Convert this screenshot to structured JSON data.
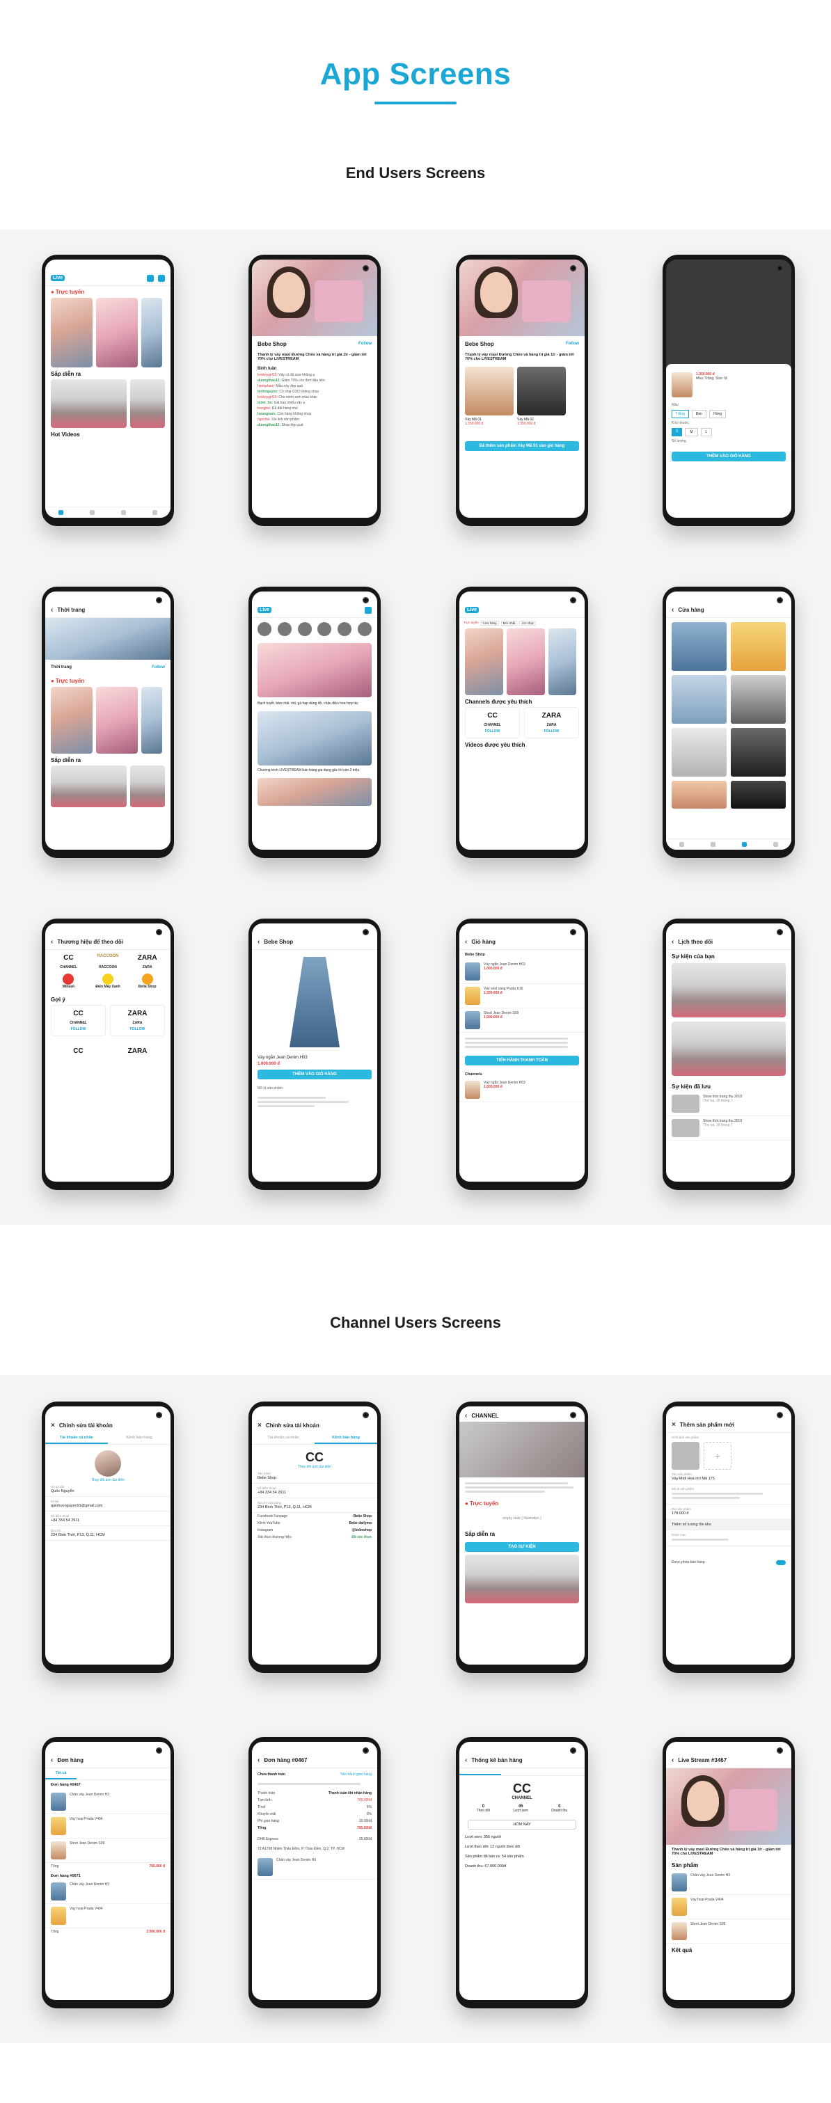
{
  "page": {
    "title": "App Screens",
    "section_end_users": "End Users Screens",
    "section_channel_users": "Channel Users Screens"
  },
  "colors": {
    "accent": "#1aa7d6",
    "live": "#e53935",
    "band": "#f4f4f5"
  },
  "screens": {
    "home": {
      "logo": "Live",
      "live": "Trực tuyến",
      "coming": "Sắp diễn ra",
      "hot": "Hot Videos"
    },
    "livestream": {
      "shop": "Bebe Shop",
      "follow": "Follow",
      "title": "Thanh lý váy maxi Đường Chéo và hàng trị giá 1tr - giảm tới 70% cho LIVESTREAM",
      "chat_title": "Bình luận"
    },
    "products": {
      "shop": "Bebe Shop",
      "follow": "Follow",
      "item1": "Váy Mã 01",
      "item2": "Váy Mã 02",
      "price1": "1.350.000 đ",
      "price2": "1.350.000 đ",
      "cta": "Đã thêm sản phẩm Váy Mã 01 vào giỏ hàng"
    },
    "variant": {
      "price": "1.350.000 đ",
      "color_label": "Màu",
      "size_label": "Kích thước",
      "qty_label": "Số lượng",
      "add": "THÊM VÀO GIỎ HÀNG"
    },
    "fashion": {
      "title": "Thời trang",
      "live": "Trực tuyến",
      "coming": "Sắp diễn ra",
      "follow": "Follow"
    },
    "categories": {
      "logo": "Live",
      "video1": "Bạch tuyết, bàn chải, nồi, gà hạp dùng đồ, chậu điện hoa hợp tác",
      "video2": "Chương trình LIVESTREAM bán hàng gia dụng giá chỉ còn 2 triệu"
    },
    "favorites": {
      "tab1": "Trực tuyến",
      "tab2": "Cửa hàng",
      "tab3": "Mới nhất",
      "tab4": "Âm nhạc",
      "channels_title": "Channels được yêu thích",
      "channel1": "CHANNEL",
      "channel2": "ZARA",
      "follow": "FOLLOW",
      "videos_title": "Videos được yêu thích"
    },
    "store": {
      "title": "Cửa hàng"
    },
    "brands": {
      "title": "Thương hiệu để theo dõi",
      "b1": "CHANNEL",
      "b2": "RACCOON",
      "b3": "ZARA",
      "b4": "Minasô",
      "b5": "Điện Máy Xanh",
      "b6": "Bella Shop",
      "suggest": "Gợi ý",
      "follow": "FOLLOW"
    },
    "product_detail": {
      "shop": "Bebe Shop",
      "name": "Váy ngắn Jean Denim H03",
      "price": "1.000.000 đ",
      "add": "THÊM VÀO GIỎ HÀNG",
      "desc": "Mô tả sản phẩm"
    },
    "cart": {
      "title": "Giỏ hàng",
      "shop": "Bebe Shop",
      "item1": "Váy ngắn Jean Denim H03",
      "item2": "Váy vest vàng Prada K16",
      "item3": "Short Jean Denim S09",
      "checkout": "TIẾN HÀNH THANH TOÁN",
      "shop2": "Channels"
    },
    "schedule": {
      "title": "Lịch theo dõi",
      "events_you": "Sự kiện của bạn",
      "events_saved": "Sự kiện đã lưu"
    },
    "edit_account": {
      "title": "Chỉnh sửa tài khoản",
      "tab1": "Tài khoản cá nhân",
      "tab2": "Kênh bán hàng",
      "change_photo": "Thay đổi ảnh đại diện",
      "name_label": "Họ và tên",
      "name": "Quốc Nguyễn",
      "email_label": "Email",
      "email": "quinhuonguyen91@gmail.com",
      "phone_label": "Số điện thoại",
      "phone": "+84 334 54 2911",
      "address_label": "Địa chỉ",
      "address": "234 Bình Thời, P13, Q.11, HCM"
    },
    "edit_channel": {
      "title": "Chỉnh sửa tài khoản",
      "tab1": "Tài khoản cá nhân",
      "tab2": "Kênh bán hàng",
      "change_photo": "Thay đổi ảnh đại diện",
      "name_label": "Tên kênh",
      "name": "Bebe Shop",
      "phone_label": "Số điện thoại",
      "phone": "+84 334 54 2911",
      "address_label": "Địa chỉ cửa hàng",
      "address": "234 Bình Thời, P13, Q.11, HCM",
      "fb_label": "Facebook Fanpage",
      "fb": "Bebe Shop",
      "yt_label": "Kênh YouTube",
      "yt": "Bebe dailymo",
      "ig_label": "Instagram",
      "ig": "@bebeshop",
      "verify_label": "Xác thực thương hiệu",
      "verify": "Đã xác thực"
    },
    "channel_page": {
      "title": "CHANNEL",
      "live": "Trực tuyến",
      "empty": "empty state ( illustration )",
      "coming": "Sắp diễn ra",
      "create": "TẠO SỰ KIỆN"
    },
    "add_product": {
      "title": "Thêm sản phẩm mới",
      "photos": "Hình ảnh sản phẩm",
      "name_label": "Tên sản phẩm",
      "name": "Váy Midi Hoa nhí Mã 175",
      "desc_label": "Mô tả sản phẩm",
      "price_label": "Giá sản phẩm",
      "price": "178.000 đ",
      "qty": "Thêm số lượng tồn kho",
      "category_label": "Danh mục",
      "allow": "Được phép bán hàng"
    },
    "orders": {
      "title": "Đơn hàng",
      "tab1": "Tất cả",
      "order1": "Đơn hàng #0467",
      "order2": "Đơn hàng #0671",
      "total1": "765.000 đ",
      "total2": "2.000.000 đ"
    },
    "order_detail": {
      "title": "Đơn hàng #0467",
      "status": "Chưa thanh toán",
      "status_action": "Tiến hành giao hàng",
      "payment": "Thanh toán khi nhận hàng",
      "total": "765.000đ",
      "shipping": "DHB Express",
      "address": "72 A1708 Nhiên Thảo Đêm, P. Thảo Điền, Q.2, TP. HCM"
    },
    "stats": {
      "title": "Thống kê bán hàng",
      "brand": "CHANNEL",
      "today": "HÔM NAY",
      "views": "Lượt xem: 356 người",
      "likes": "Lượt theo dõi: 12 người theo dõi",
      "sold": "Sản phẩm đã bán ra: 54 sản phẩm",
      "revenue": "Doanh thu: 67.000.000đ"
    },
    "live_stream": {
      "title": "Live Stream #3467",
      "desc": "Thanh lý váy maxi Đường Chéo và hàng trị giá 1tr - giảm tới 70% cho LIVESTREAM",
      "products": "Sản phẩm",
      "result": "Kết quả"
    }
  }
}
